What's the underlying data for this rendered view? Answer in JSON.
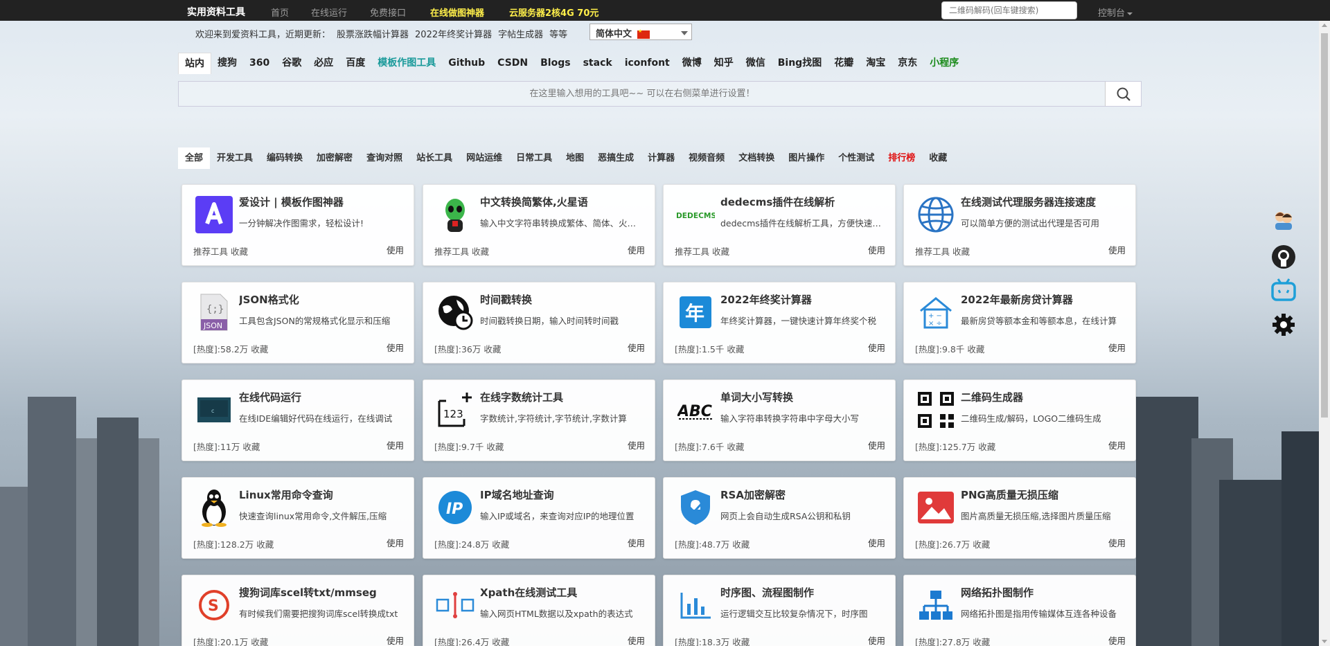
{
  "topnav": {
    "logo": "实用资料工具",
    "links": [
      "首页",
      "在线运行",
      "免费接口"
    ],
    "highlight1": "在线做图神器",
    "highlight2": "云服务器2核4G 70元",
    "search_placeholder": "二维码解码(回车键搜索)",
    "control": "控制台"
  },
  "welcome": {
    "intro": "欢迎来到爱资料工具，近期更新：",
    "updates": [
      "股票涨跌幅计算器",
      "2022年终奖计算器",
      "字帖生成器"
    ],
    "etc": "等等",
    "language": "简体中文"
  },
  "engines": [
    "站内",
    "搜狗",
    "360",
    "谷歌",
    "必应",
    "百度",
    "模板作图工具",
    "Github",
    "CSDN",
    "Blogs",
    "stack",
    "iconfont",
    "微博",
    "知乎",
    "微信",
    "Bing找图",
    "花瓣",
    "淘宝",
    "京东",
    "小程序"
  ],
  "search": {
    "placeholder": "在这里输入想用的工具吧~~ 可以在右侧菜单进行设置！"
  },
  "categories": [
    "全部",
    "开发工具",
    "编码转换",
    "加密解密",
    "查询对照",
    "站长工具",
    "网站运维",
    "日常工具",
    "地图",
    "恶搞生成",
    "计算器",
    "视频音频",
    "文档转换",
    "图片操作",
    "个性测试",
    "排行榜",
    "收藏"
  ],
  "card_use": "使用",
  "cards": [
    {
      "title": "爱设计 | 模板作图神器",
      "desc": "一分钟解决作图需求，轻松设计!",
      "meta": "推荐工具 收藏",
      "icon": "aisheji-icon"
    },
    {
      "title": "中文转换简繁体,火星语",
      "desc": "输入中文字符串转换成繁体、简体、火星文",
      "meta": "推荐工具 收藏",
      "icon": "martian-icon"
    },
    {
      "title": "dedecms插件在线解析",
      "desc": "dedecms插件在线解析工具，方便快速查看",
      "meta": "推荐工具 收藏",
      "icon": "dedecms-icon"
    },
    {
      "title": "在线测试代理服务器连接速度",
      "desc": "可以简单方便的测试出代理是否可用",
      "meta": "推荐工具 收藏",
      "icon": "globe-icon"
    },
    {
      "title": "JSON格式化",
      "desc": "工具包含JSON的常规格式化显示和压缩",
      "meta": "[热度]:58.2万 收藏",
      "icon": "json-icon"
    },
    {
      "title": "时间戳转换",
      "desc": "时间戳转换日期，输入时间转时间戳",
      "meta": "[热度]:36万 收藏",
      "icon": "clock-globe-icon"
    },
    {
      "title": "2022年终奖计算器",
      "desc": "年终奖计算器，一键快速计算年终奖个税",
      "meta": "[热度]:1.5千 收藏",
      "icon": "year-icon"
    },
    {
      "title": "2022年最新房贷计算器",
      "desc": "最新房贷等额本金和等额本息，在线计算",
      "meta": "[热度]:9.8千 收藏",
      "icon": "house-calc-icon"
    },
    {
      "title": "在线代码运行",
      "desc": "在线IDE编辑好代码在线运行，在线调试",
      "meta": "[热度]:11万 收藏",
      "icon": "ide-icon"
    },
    {
      "title": "在线字数统计工具",
      "desc": "字数统计,字符统计,字节统计,字数计算",
      "meta": "[热度]:9.7千 收藏",
      "icon": "count-icon"
    },
    {
      "title": "单词大小写转换",
      "desc": "输入字符串转换字符串中字母大小写",
      "meta": "[热度]:7.6千 收藏",
      "icon": "abc-icon"
    },
    {
      "title": "二维码生成器",
      "desc": "二维码生成/解码，LOGO二维码生成",
      "meta": "[热度]:125.7万 收藏",
      "icon": "qrcode-icon"
    },
    {
      "title": "Linux常用命令查询",
      "desc": "快速查询linux常用命令,文件解压,压缩",
      "meta": "[热度]:128.2万 收藏",
      "icon": "tux-icon"
    },
    {
      "title": "IP域名地址查询",
      "desc": "输入IP或域名，来查询对应IP的地理位置",
      "meta": "[热度]:24.8万 收藏",
      "icon": "ip-icon"
    },
    {
      "title": "RSA加密解密",
      "desc": "网页上会自动生成RSA公钥和私钥",
      "meta": "[热度]:48.7万 收藏",
      "icon": "shield-icon"
    },
    {
      "title": "PNG高质量无损压缩",
      "desc": "图片高质量无损压缩,选择图片质量压缩",
      "meta": "[热度]:26.7万 收藏",
      "icon": "image-icon"
    },
    {
      "title": "搜狗词库scel转txt/mmseg",
      "desc": "有时候我们需要把搜狗词库scel转换成txt",
      "meta": "[热度]:20.1万 收藏",
      "icon": "sogou-icon"
    },
    {
      "title": "Xpath在线测试工具",
      "desc": "输入网页HTML数据以及xpath的表达式",
      "meta": "[热度]:26.4万 收藏",
      "icon": "xpath-icon"
    },
    {
      "title": "时序图、流程图制作",
      "desc": "运行逻辑交互比较复杂情况下，时序图",
      "meta": "[热度]:18.3万 收藏",
      "icon": "chart-icon"
    },
    {
      "title": "网络拓扑图制作",
      "desc": "网络拓扑图是指用传输媒体互连各种设备",
      "meta": "[热度]:27.8万 收藏",
      "icon": "topology-icon"
    }
  ],
  "side": [
    "qq-group-icon",
    "github-icon",
    "bilibili-icon",
    "settings-gear-icon"
  ]
}
